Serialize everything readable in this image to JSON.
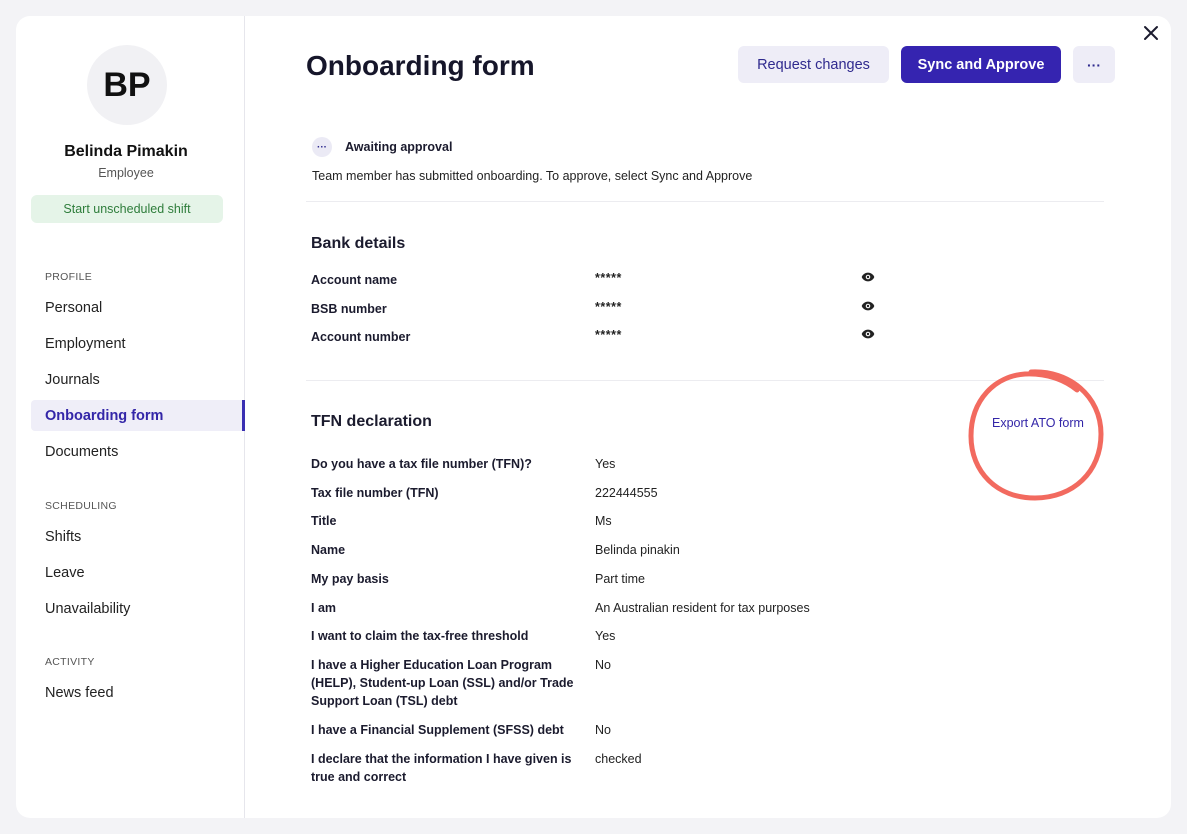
{
  "colors": {
    "primary": "#3524b0",
    "secondary_bg": "#eeedf7",
    "shift_bg": "#e5f4e8",
    "shift_text": "#2e7d3b",
    "annotation": "#f26a5f"
  },
  "sidebar": {
    "avatar_initials": "BP",
    "name": "Belinda Pimakin",
    "role": "Employee",
    "shift_button": "Start unscheduled shift",
    "sections": {
      "profile": "PROFILE",
      "scheduling": "SCHEDULING",
      "activity": "ACTIVITY"
    },
    "items": {
      "personal": "Personal",
      "employment": "Employment",
      "journals": "Journals",
      "onboarding": "Onboarding form",
      "documents": "Documents",
      "shifts": "Shifts",
      "leave": "Leave",
      "unavailability": "Unavailability",
      "news_feed": "News feed"
    }
  },
  "header": {
    "title": "Onboarding form",
    "request_changes": "Request changes",
    "sync_approve": "Sync and Approve",
    "more": "···"
  },
  "status": {
    "icon": "···",
    "title": "Awaiting approval",
    "description": "Team member has submitted onboarding. To approve, select Sync and Approve"
  },
  "bank": {
    "title": "Bank details",
    "fields": [
      {
        "label": "Account name",
        "value": "*****"
      },
      {
        "label": "BSB number",
        "value": "*****"
      },
      {
        "label": "Account number",
        "value": "*****"
      }
    ]
  },
  "tfn": {
    "title": "TFN declaration",
    "export_link": "Export ATO form",
    "fields": [
      {
        "label": "Do you have a tax file number (TFN)?",
        "value": "Yes"
      },
      {
        "label": "Tax file number (TFN)",
        "value": "222444555"
      },
      {
        "label": "Title",
        "value": "Ms"
      },
      {
        "label": "Name",
        "value": "Belinda pinakin"
      },
      {
        "label": "My pay basis",
        "value": "Part time"
      },
      {
        "label": "I am",
        "value": "An Australian resident for tax purposes"
      },
      {
        "label": "I want to claim the tax-free threshold",
        "value": "Yes"
      },
      {
        "label": "I have a Higher Education Loan Program (HELP), Student-up Loan (SSL) and/or Trade Support Loan (TSL) debt",
        "value": "No"
      },
      {
        "label": "I have a Financial Supplement (SFSS) debt",
        "value": "No"
      },
      {
        "label": "I declare that the information I have given is true and correct",
        "value": "checked"
      }
    ]
  }
}
